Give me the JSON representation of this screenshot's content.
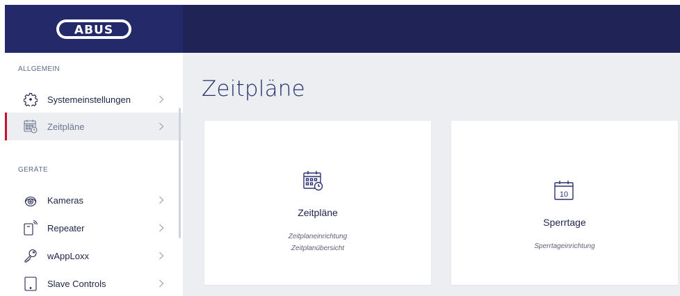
{
  "brand": {
    "logo_text": "ABUS"
  },
  "sidebar": {
    "sections": [
      {
        "label": "ALLGEMEIN"
      },
      {
        "label": "GERÄTE"
      }
    ],
    "items": [
      {
        "label": "Systemeinstellungen",
        "icon": "gear-icon"
      },
      {
        "label": "Zeitpläne",
        "icon": "calendar-clock-icon",
        "active": true
      },
      {
        "label": "Kameras",
        "icon": "camera-icon"
      },
      {
        "label": "Repeater",
        "icon": "repeater-icon"
      },
      {
        "label": "wAppLoxx",
        "icon": "key-icon"
      },
      {
        "label": "Slave Controls",
        "icon": "tablet-icon"
      }
    ]
  },
  "main": {
    "title": "Zeitpläne",
    "cards": [
      {
        "title": "Zeitpläne",
        "icon": "calendar-clock-icon",
        "subtitles": [
          "Zeitplaneinrichtung",
          "Zeitplanübersicht"
        ]
      },
      {
        "title": "Sperrtage",
        "icon": "calendar-10-icon",
        "icon_text": "10",
        "subtitles": [
          "Sperrtageinrichtung"
        ]
      }
    ]
  },
  "colors": {
    "topbar": "#1f2355",
    "logo_bg": "#24296a",
    "accent_red": "#c8102e",
    "text_dark": "#1e2248",
    "title_blue": "#25306b",
    "content_bg": "#eceef2"
  }
}
